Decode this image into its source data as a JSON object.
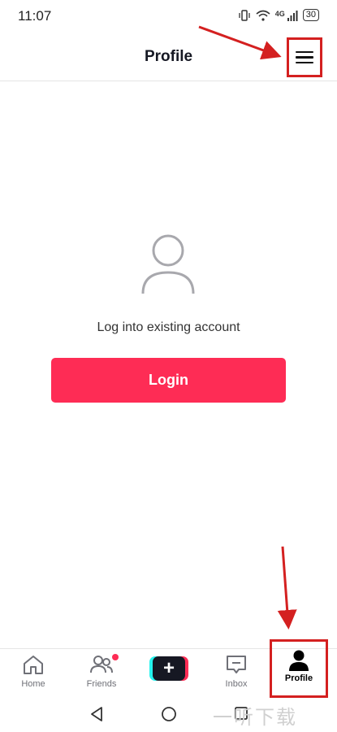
{
  "status_bar": {
    "time": "11:07",
    "network_label": "4G",
    "battery_level": "30"
  },
  "header": {
    "title": "Profile"
  },
  "main": {
    "prompt": "Log into existing account",
    "login_label": "Login"
  },
  "bottom_nav": {
    "items": [
      {
        "label": "Home",
        "icon": "home-icon"
      },
      {
        "label": "Friends",
        "icon": "friends-icon",
        "has_badge": true
      },
      {
        "label": "",
        "icon": "plus-icon"
      },
      {
        "label": "Inbox",
        "icon": "inbox-icon"
      },
      {
        "label": "Profile",
        "icon": "profile-icon",
        "active": true
      }
    ]
  },
  "watermark": "一听下载",
  "colors": {
    "brand": "#fe2c55",
    "annotation": "#d42020",
    "text": "#161823"
  }
}
